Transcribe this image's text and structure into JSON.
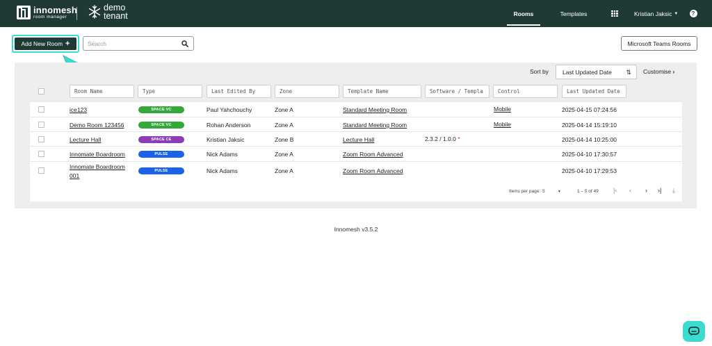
{
  "header": {
    "brand_name": "innomesh",
    "brand_sub": "room manager",
    "tenant_line1": "demo",
    "tenant_line2": "tenant",
    "nav": [
      {
        "label": "Rooms",
        "active": true
      },
      {
        "label": "Templates",
        "active": false
      }
    ],
    "user": "Kristian Jaksic",
    "help": "?",
    "icons": [
      "apps-grid-icon",
      "caret-down-icon",
      "help-icon"
    ]
  },
  "toolbar": {
    "add_label": "Add New Room",
    "add_plus": "+",
    "search_placeholder": "Search",
    "teams_label": "Microsoft Teams Rooms"
  },
  "sort": {
    "label": "Sort by",
    "value": "Last Updated Date",
    "customise": "Customise"
  },
  "columns": [
    "Room Name",
    "Type",
    "Last Edited By",
    "Zone",
    "Template Name",
    "Software / Templa",
    "Control",
    "Last Updated Date"
  ],
  "rows": [
    {
      "name": "ice123",
      "name2": "",
      "type": "SPACE VC",
      "type_color": "#34a83a",
      "editor": "Paul Yahchouchy",
      "zone": "Zone A",
      "template": "Standard Meeting Room",
      "software": "",
      "req": "",
      "control": "Mobile",
      "updated": "2025-04-15 07:24:56"
    },
    {
      "name": "Demo Room 123456",
      "name2": "",
      "type": "SPACE VC",
      "type_color": "#34a83a",
      "editor": "Rohan Anderson",
      "zone": "Zone A",
      "template": "Standard Meeting Room",
      "software": "",
      "req": "",
      "control": "Mobile",
      "updated": "2025-04-14 15:19:10"
    },
    {
      "name": "Lecture Hall",
      "name2": "",
      "type": "SPACE CE",
      "type_color": "#8a3db5",
      "editor": "Kristian Jaksic",
      "zone": "Zone B",
      "template": "Lecture Hall",
      "software": "2.3.2 / 1.0.0",
      "req": "*",
      "control": "",
      "updated": "2025-04-14 10:25:00"
    },
    {
      "name": "Innomate Boardroom",
      "name2": "",
      "type": "PULSE",
      "type_color": "#1a63e8",
      "editor": "Nick Adams",
      "zone": "Zone A",
      "template": "Zoom Room Advanced",
      "software": "",
      "req": "",
      "control": "",
      "updated": "2025-04-10 17:30:57"
    },
    {
      "name": "Innomate Boardroom",
      "name2": "001",
      "type": "PULSE",
      "type_color": "#1a63e8",
      "editor": "Nick Adams",
      "zone": "Zone A",
      "template": "Zoom Room Advanced",
      "software": "",
      "req": "",
      "control": "",
      "updated": "2025-04-10 17:29:53"
    }
  ],
  "pagination": {
    "per_page_label": "Items per page:",
    "per_page_value": "5",
    "range": "1 – 5 of 49"
  },
  "footer": {
    "version": "Innomesh v3.5.2"
  },
  "colors": {
    "header_bg": "#1f3a34",
    "accent_teal": "#3ddbcf",
    "space_vc": "#34a83a",
    "space_ce": "#8a3db5",
    "pulse": "#1a63e8"
  }
}
